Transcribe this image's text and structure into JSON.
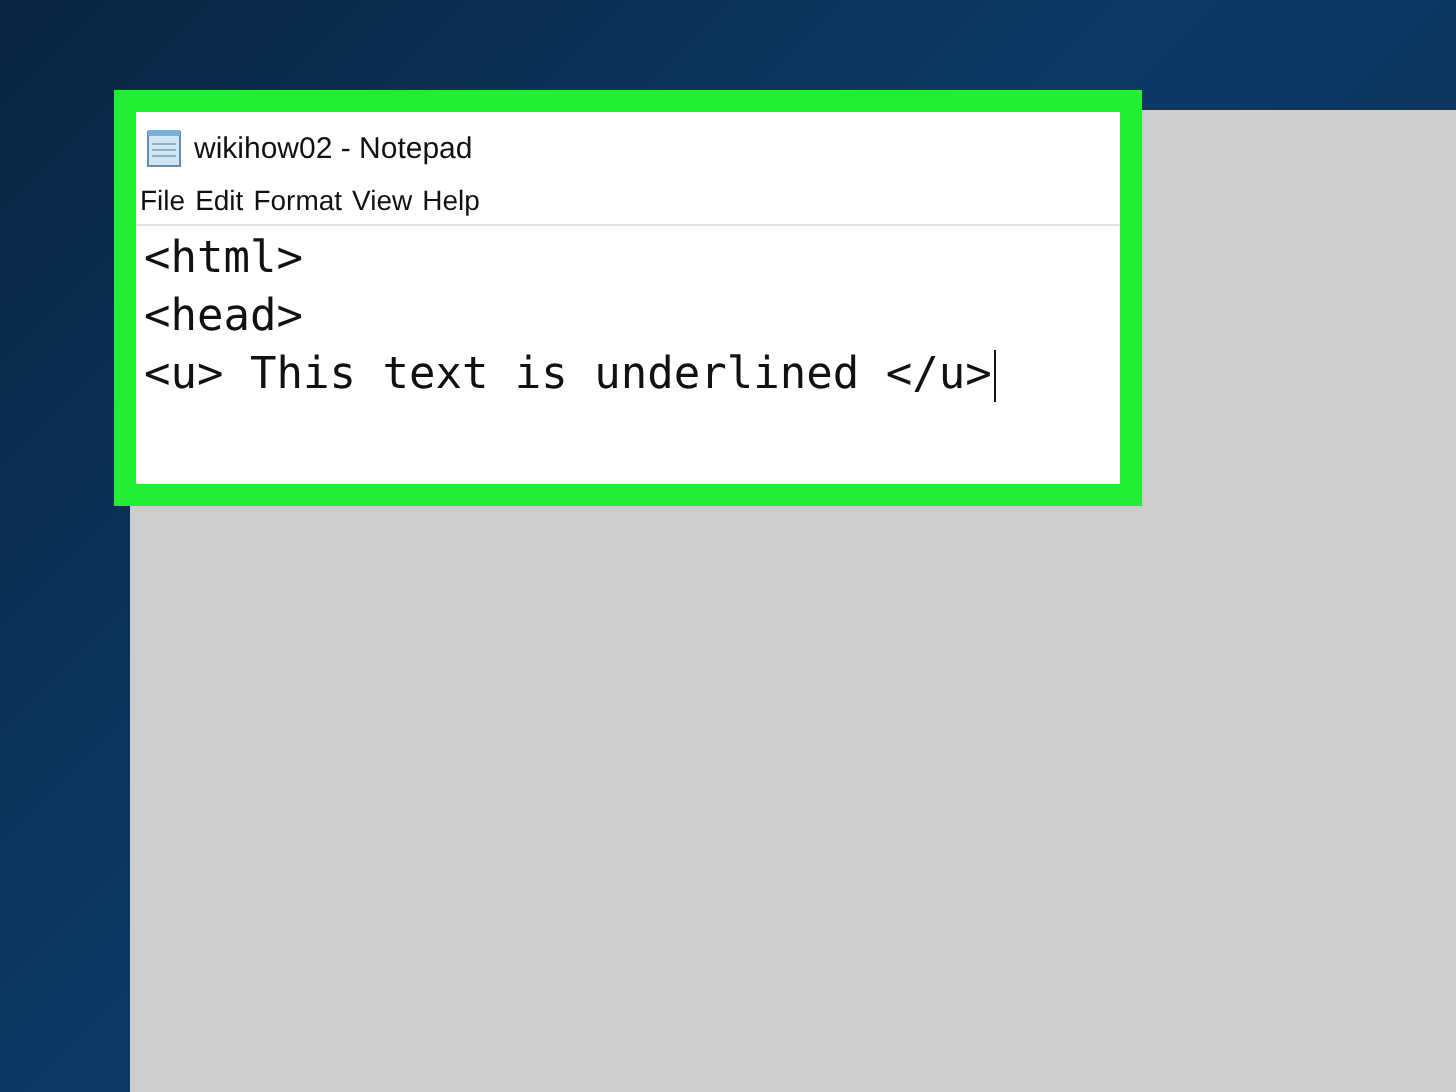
{
  "window": {
    "title": "wikihow02 - Notepad"
  },
  "menu": [
    "File",
    "Edit",
    "Format",
    "View",
    "Help"
  ],
  "editor": {
    "lines": [
      "<html>",
      "<head>",
      "<u> This text is underlined </u>"
    ]
  }
}
